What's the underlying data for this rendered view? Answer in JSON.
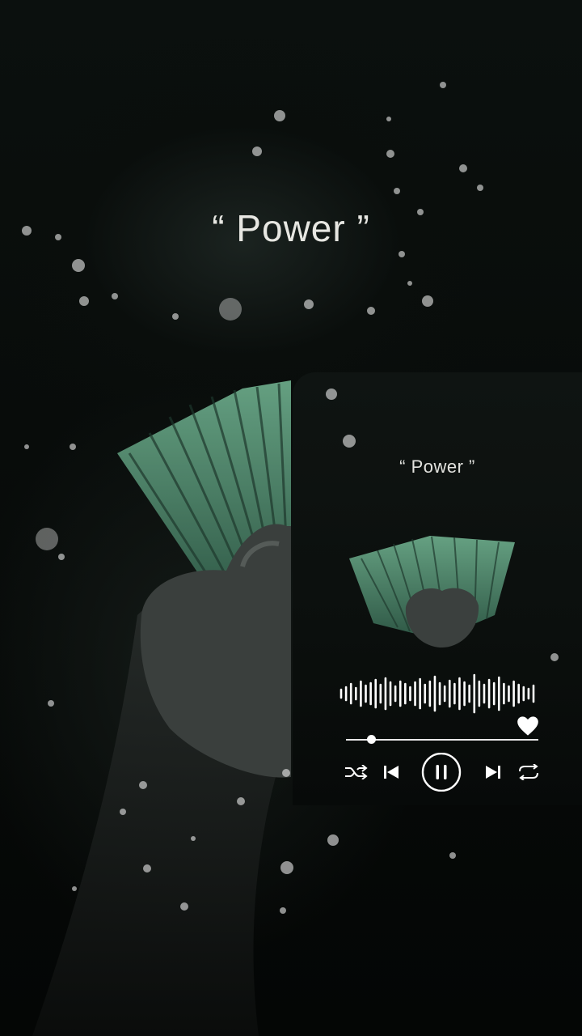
{
  "background": {
    "title": "“ Power ”"
  },
  "player": {
    "title": "“ Power ”",
    "progress": 0.13,
    "liked": true,
    "is_playing": true,
    "controls": [
      "shuffle-icon",
      "previous-icon",
      "pause-icon",
      "next-icon",
      "repeat-icon"
    ]
  },
  "colors": {
    "note_green": "#4f8f70",
    "foreground": "#ffffff",
    "background": "#050706"
  }
}
